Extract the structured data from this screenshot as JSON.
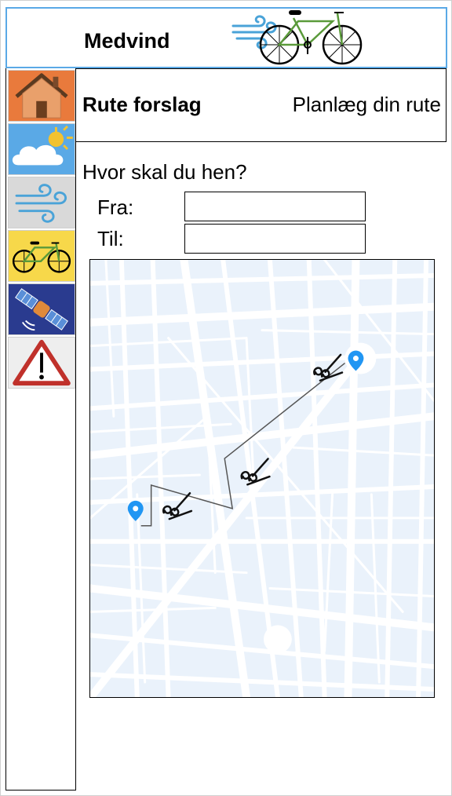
{
  "app": {
    "title": "Medvind",
    "logo_icon": "bicycle-with-wind-icon"
  },
  "sidebar": {
    "items": [
      {
        "name": "home",
        "icon": "house-icon",
        "bg": "#e97a3c"
      },
      {
        "name": "weather",
        "icon": "cloud-sun-icon",
        "bg": "#5aa9e6"
      },
      {
        "name": "wind",
        "icon": "wind-icon",
        "bg": "#d9d9d9"
      },
      {
        "name": "bike",
        "icon": "bicycle-icon",
        "bg": "#f7d84a"
      },
      {
        "name": "satellite",
        "icon": "satellite-icon",
        "bg": "#2a3b8f"
      },
      {
        "name": "warning",
        "icon": "warning-triangle-icon",
        "bg": "#eeeeee"
      }
    ]
  },
  "page": {
    "title": "Rute forslag",
    "subtitle": "Planlæg din rute"
  },
  "form": {
    "question": "Hvor skal du hen?",
    "from_label": "Fra:",
    "to_label": "Til:",
    "from_value": "",
    "to_value": ""
  },
  "map": {
    "marker_color": "#2196f3",
    "route_color": "#555555",
    "street_color": "#ffffff",
    "block_color": "#eef4fb",
    "wind_icon": "wind-gust-icon"
  }
}
